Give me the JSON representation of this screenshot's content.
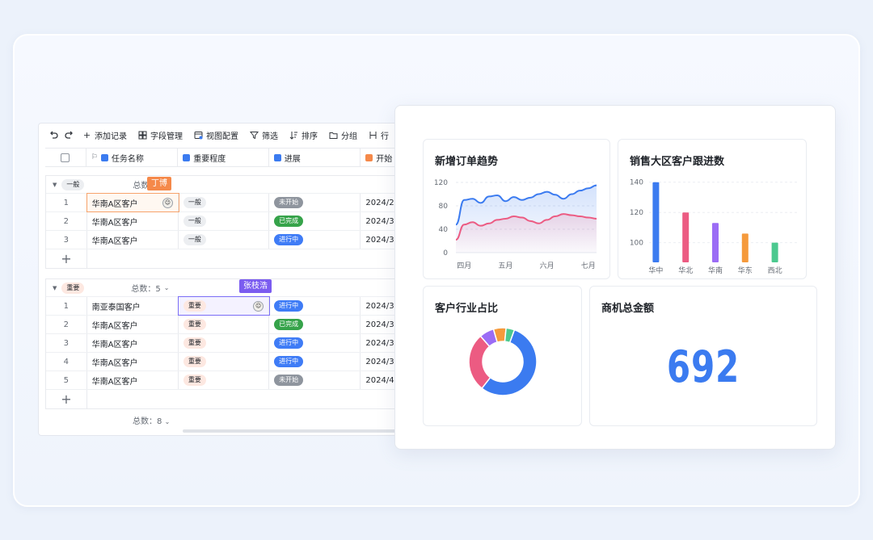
{
  "toolbar": {
    "undo_icon": "undo-icon",
    "redo_icon": "redo-icon",
    "items": [
      {
        "label": "添加记录",
        "icon": "plus-icon"
      },
      {
        "label": "字段管理",
        "icon": "grid-icon"
      },
      {
        "label": "视图配置",
        "icon": "view-config-icon"
      },
      {
        "label": "筛选",
        "icon": "filter-icon"
      },
      {
        "label": "排序",
        "icon": "sort-icon"
      },
      {
        "label": "分组",
        "icon": "folder-icon"
      },
      {
        "label": "行",
        "icon": "row-height-icon"
      }
    ]
  },
  "table": {
    "columns": [
      "任务名称",
      "重要程度",
      "进展",
      "开始"
    ],
    "groups": [
      {
        "label": "一般",
        "total_label": "总数",
        "rows": [
          {
            "n": "1",
            "name": "华南A区客户",
            "level": "一般",
            "status": "未开始",
            "start": "2024/2"
          },
          {
            "n": "2",
            "name": "华南A区客户",
            "level": "一般",
            "status": "已完成",
            "start": "2024/3"
          },
          {
            "n": "3",
            "name": "华南A区客户",
            "level": "一般",
            "status": "进行中",
            "start": "2024/3"
          }
        ]
      },
      {
        "label": "重要",
        "total_label": "总数：5",
        "rows": [
          {
            "n": "1",
            "name": "南亚泰国客户",
            "level": "重要",
            "status": "进行中",
            "start": "2024/3"
          },
          {
            "n": "2",
            "name": "华南A区客户",
            "level": "重要",
            "status": "已完成",
            "start": "2024/3"
          },
          {
            "n": "3",
            "name": "华南A区客户",
            "level": "重要",
            "status": "进行中",
            "start": "2024/3"
          },
          {
            "n": "4",
            "name": "华南A区客户",
            "level": "重要",
            "status": "进行中",
            "start": "2024/3"
          },
          {
            "n": "5",
            "name": "华南A区客户",
            "level": "重要",
            "status": "未开始",
            "start": "2024/4"
          }
        ]
      }
    ],
    "grand_total": "总数：8",
    "add_symbol": "+"
  },
  "cursors": {
    "user1": "丁博",
    "user2": "张枝浩"
  },
  "colors": {
    "accent": "#3b7bf0",
    "cursor1": "#f5894a",
    "cursor2": "#7b5cf0"
  },
  "dashboard": {
    "order_trend_title": "新增订单趋势",
    "followup_title": "销售大区客户跟进数",
    "industry_title": "客户行业占比",
    "amount_title": "商机总金额",
    "amount_value": "692"
  },
  "chart_data": [
    {
      "type": "area",
      "title": "新增订单趋势",
      "categories": [
        "四月",
        "五月",
        "六月",
        "七月"
      ],
      "yticks": [
        0,
        40,
        80,
        120
      ],
      "ylim": [
        0,
        120
      ],
      "x": [
        0,
        0.2,
        0.4,
        0.6,
        0.8,
        1.0,
        1.2,
        1.4,
        1.6,
        1.8,
        2.0,
        2.2,
        2.4,
        2.6,
        2.8,
        3.0,
        3.2,
        3.4
      ],
      "series": [
        {
          "color": "#3b7bf0",
          "values": [
            48,
            90,
            92,
            85,
            96,
            98,
            88,
            95,
            90,
            94,
            100,
            104,
            99,
            92,
            100,
            106,
            110,
            115
          ]
        },
        {
          "color": "#ec5b82",
          "values": [
            22,
            48,
            52,
            46,
            50,
            56,
            58,
            62,
            60,
            54,
            50,
            56,
            62,
            66,
            64,
            62,
            60,
            58
          ]
        }
      ]
    },
    {
      "type": "bar",
      "title": "销售大区客户跟进数",
      "categories": [
        "华中",
        "华北",
        "华南",
        "华东",
        "西北"
      ],
      "yticks": [
        100,
        120,
        140
      ],
      "ylim": [
        87,
        142
      ],
      "values": [
        140,
        120,
        113,
        106,
        100
      ],
      "colors": [
        "#3b7bf0",
        "#ec5b82",
        "#9b6cf5",
        "#f59a3c",
        "#4cc98f"
      ]
    },
    {
      "type": "pie",
      "title": "客户行业占比",
      "values": [
        55,
        28,
        7,
        6,
        4
      ],
      "colors": [
        "#3b7bf0",
        "#ec5b82",
        "#9b6cf5",
        "#f59a3c",
        "#4cc98f"
      ]
    }
  ]
}
